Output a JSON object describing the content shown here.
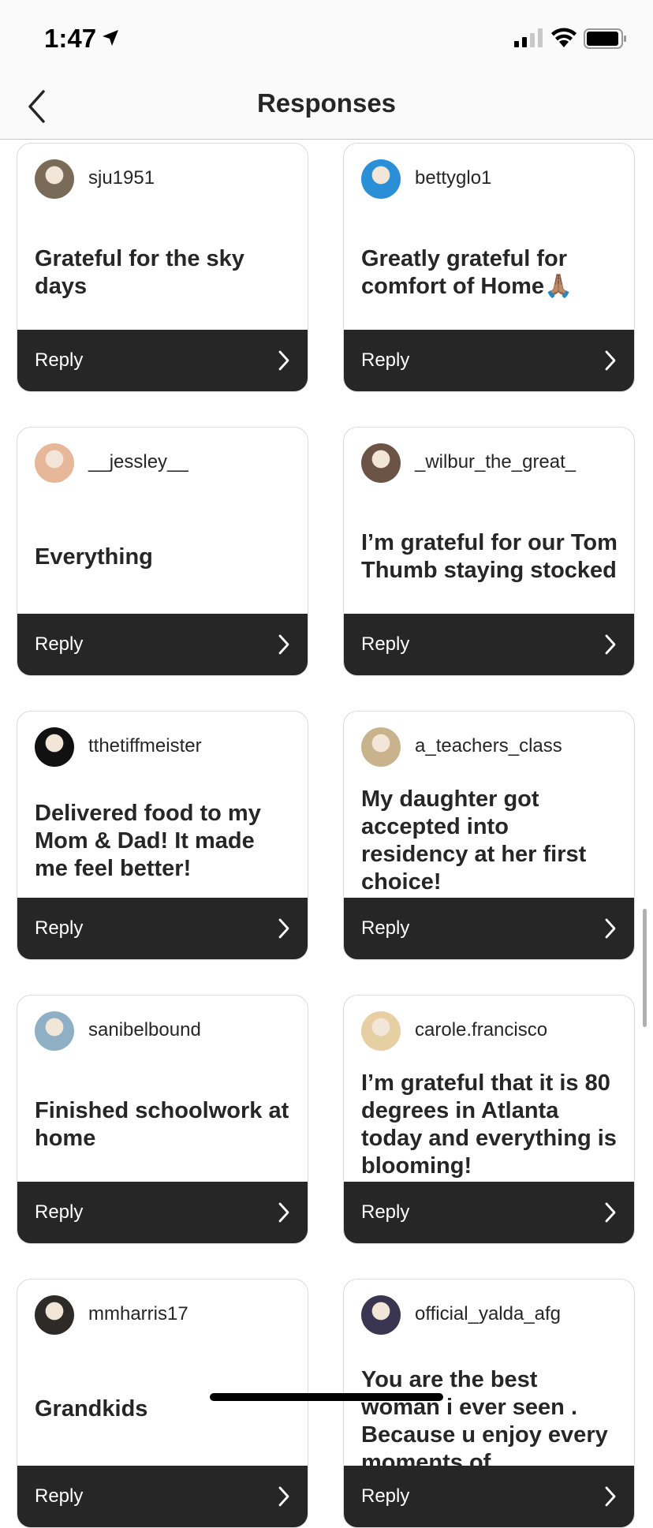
{
  "status_bar": {
    "time": "1:47",
    "icons": [
      "location-arrow-icon",
      "cellular-signal-icon",
      "wifi-icon",
      "battery-icon"
    ]
  },
  "nav": {
    "title": "Responses",
    "back_icon": "chevron-left-icon"
  },
  "colors": {
    "card_border": "#dbdbdb",
    "reply_bar": "#262626",
    "text": "#262626",
    "header_bg": "#fafafa"
  },
  "responses": [
    {
      "username": "sju1951",
      "text": "Grateful for the sky days",
      "reply": "Reply",
      "avatar_color": "#7a6a58"
    },
    {
      "username": "bettyglo1",
      "text": "Greatly grateful for comfort of Home🙏🏽",
      "reply": "Reply",
      "avatar_color": "#2a8fd6"
    },
    {
      "username": "__jessley__",
      "text": "Everything",
      "reply": "Reply",
      "avatar_color": "#e7b79a"
    },
    {
      "username": "_wilbur_the_great_",
      "text": "I’m grateful for our Tom Thumb staying stocked",
      "reply": "Reply",
      "avatar_color": "#6b5446"
    },
    {
      "username": "tthetiffmeister",
      "text": "Delivered food to my Mom & Dad! It made me feel better!",
      "reply": "Reply",
      "avatar_color": "#111111"
    },
    {
      "username": "a_teachers_class",
      "text": "My daughter got accepted into residency at her first choice!",
      "reply": "Reply",
      "avatar_color": "#c9b38d"
    },
    {
      "username": "sanibelbound",
      "text": "Finished schoolwork at home",
      "reply": "Reply",
      "avatar_color": "#8fb0c4"
    },
    {
      "username": "carole.francisco",
      "text": "I’m grateful that it is 80 degrees in Atlanta today and everything is blooming!",
      "reply": "Reply",
      "avatar_color": "#e6cfa3"
    },
    {
      "username": "mmharris17",
      "text": "Grandkids",
      "reply": "Reply",
      "avatar_color": "#2e2a28"
    },
    {
      "username": "official_yalda_afg",
      "text": "You are the best woman i ever seen . Because u enjoy every moments of",
      "reply": "Reply",
      "avatar_color": "#3a3550"
    }
  ]
}
